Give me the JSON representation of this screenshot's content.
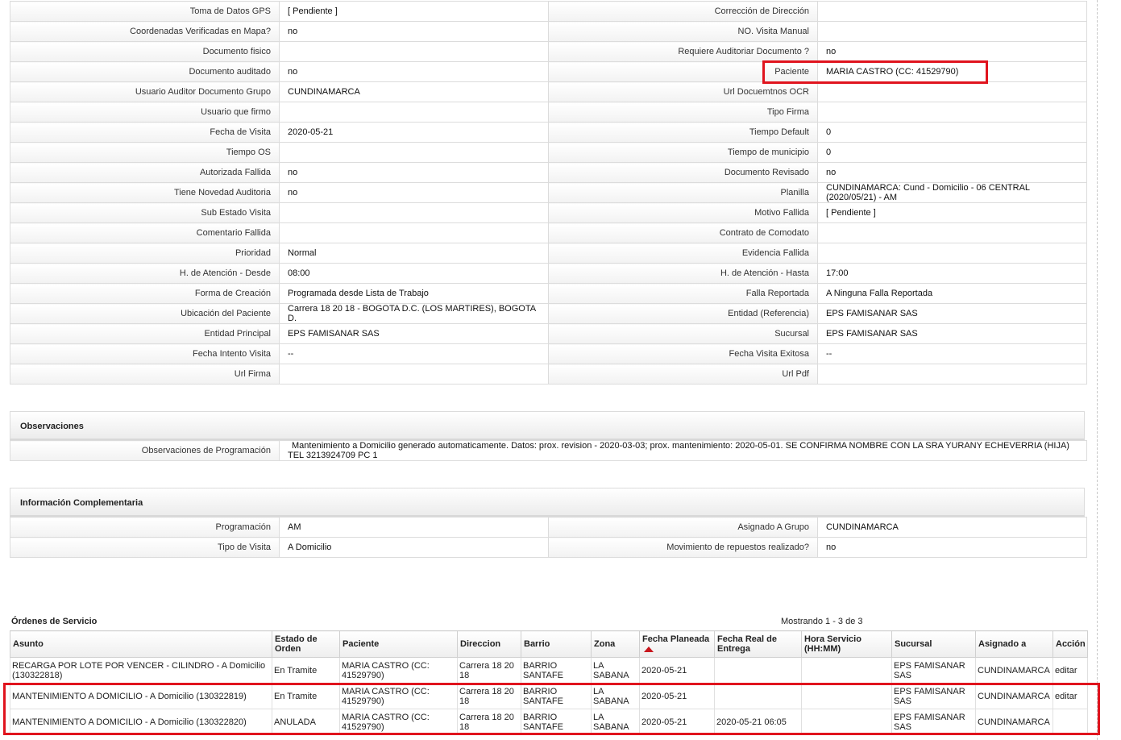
{
  "details": {
    "rows": [
      {
        "l1": "Toma de Datos GPS",
        "v1": "[ Pendiente ]",
        "l2": "Corrección de Dirección",
        "v2": ""
      },
      {
        "l1": "Coordenadas Verificadas en Mapa?",
        "v1": "no",
        "l2": "NO. Visita Manual",
        "v2": ""
      },
      {
        "l1": "Documento fisico",
        "v1": "",
        "l2": "Requiere Auditoriar Documento ?",
        "v2": "no"
      },
      {
        "l1": "Documento auditado",
        "v1": "no",
        "l2": "Paciente",
        "v2": "MARIA CASTRO (CC: 41529790)"
      },
      {
        "l1": "Usuario Auditor Documento Grupo",
        "v1": "CUNDINAMARCA",
        "l2": "Url Docuemtnos OCR",
        "v2": ""
      },
      {
        "l1": "Usuario que firmo",
        "v1": "",
        "l2": "Tipo Firma",
        "v2": ""
      },
      {
        "l1": "Fecha de Visita",
        "v1": "2020-05-21",
        "l2": "Tiempo Default",
        "v2": "0"
      },
      {
        "l1": "Tiempo OS",
        "v1": "",
        "l2": "Tiempo de municipio",
        "v2": "0"
      },
      {
        "l1": "Autorizada Fallida",
        "v1": "no",
        "l2": "Documento Revisado",
        "v2": "no"
      },
      {
        "l1": "Tiene Novedad Auditoria",
        "v1": "no",
        "l2": "Planilla",
        "v2": "CUNDINAMARCA: Cund - Domicilio - 06 CENTRAL (2020/05/21) - AM"
      },
      {
        "l1": "Sub Estado Visita",
        "v1": "",
        "l2": "Motivo Fallida",
        "v2": "[ Pendiente ]"
      },
      {
        "l1": "Comentario Fallida",
        "v1": "",
        "l2": "Contrato de Comodato",
        "v2": ""
      },
      {
        "l1": "Prioridad",
        "v1": "Normal",
        "l2": "Evidencia Fallida",
        "v2": ""
      },
      {
        "l1": "H. de Atención - Desde",
        "v1": "08:00",
        "l2": "H. de Atención - Hasta",
        "v2": "17:00"
      },
      {
        "l1": "Forma de Creación",
        "v1": "Programada desde Lista de Trabajo",
        "l2": "Falla Reportada",
        "v2": "A Ninguna Falla Reportada"
      },
      {
        "l1": "Ubicación del Paciente",
        "v1": "Carrera 18 20 18 - BOGOTA D.C. (LOS MARTIRES), BOGOTA D.",
        "l2": "Entidad (Referencia)",
        "v2": "EPS FAMISANAR SAS"
      },
      {
        "l1": "Entidad Principal",
        "v1": "EPS FAMISANAR SAS",
        "l2": "Sucursal",
        "v2": "EPS FAMISANAR SAS"
      },
      {
        "l1": "Fecha Intento Visita",
        "v1": "--",
        "l2": "Fecha Visita Exitosa",
        "v2": "--"
      },
      {
        "l1": "Url Firma",
        "v1": "",
        "l2": "Url Pdf",
        "v2": ""
      }
    ]
  },
  "observaciones": {
    "title": "Observaciones",
    "label": "Observaciones de Programación",
    "value": "Mantenimiento a Domicilio generado automaticamente. Datos: prox. revision - 2020-03-03; prox. mantenimiento: 2020-05-01. SE CONFIRMA NOMBRE CON LA SRA YURANY ECHEVERRIA (HIJA) TEL 3213924709 PC 1"
  },
  "complementaria": {
    "title": "Información Complementaria",
    "rows": [
      {
        "l1": "Programación",
        "v1": "AM",
        "l2": "Asignado A Grupo",
        "v2": "CUNDINAMARCA"
      },
      {
        "l1": "Tipo de Visita",
        "v1": "A Domicilio",
        "l2": "Movimiento de repuestos realizado?",
        "v2": "no"
      }
    ]
  },
  "orders": {
    "title": "Órdenes de Servicio",
    "count": "Mostrando 1 - 3 de 3",
    "columns": [
      "Asunto",
      "Estado de Orden",
      "Paciente",
      "Direccion",
      "Barrio",
      "Zona",
      "Fecha Planeada",
      "Fecha Real de Entrega",
      "Hora Servicio (HH:MM)",
      "Sucursal",
      "Asignado a",
      "Acción"
    ],
    "sort_indicator": "sort-descending-icon",
    "rows": [
      {
        "asunto": "RECARGA POR LOTE POR VENCER - CILINDRO - A Domicilio (130322818)",
        "estado": "En Tramite",
        "paciente": "MARIA CASTRO (CC: 41529790)",
        "direccion": "Carrera 18 20 18",
        "barrio": "BARRIO SANTAFE",
        "zona": "LA SABANA",
        "fecha_planeada": "2020-05-21",
        "fecha_real": "",
        "hora": "",
        "sucursal": "EPS FAMISANAR SAS",
        "asignado": "CUNDINAMARCA",
        "accion": "editar"
      },
      {
        "asunto": "MANTENIMIENTO A DOMICILIO - A Domicilio (130322819)",
        "estado": "En Tramite",
        "paciente": "MARIA CASTRO (CC: 41529790)",
        "direccion": "Carrera 18 20 18",
        "barrio": "BARRIO SANTAFE",
        "zona": "LA SABANA",
        "fecha_planeada": "2020-05-21",
        "fecha_real": "",
        "hora": "",
        "sucursal": "EPS FAMISANAR SAS",
        "asignado": "CUNDINAMARCA",
        "accion": "editar"
      },
      {
        "asunto": "MANTENIMIENTO A DOMICILIO - A Domicilio (130322820)",
        "estado": "ANULADA",
        "paciente": "MARIA CASTRO (CC: 41529790)",
        "direccion": "Carrera 18 20 18",
        "barrio": "BARRIO SANTAFE",
        "zona": "LA SABANA",
        "fecha_planeada": "2020-05-21",
        "fecha_real": "2020-05-21 06:05",
        "hora": "",
        "sucursal": "EPS FAMISANAR SAS",
        "asignado": "CUNDINAMARCA",
        "accion": ""
      }
    ]
  },
  "colors": {
    "highlight": "#e0141e",
    "sort_arrow": "#c8161d"
  }
}
